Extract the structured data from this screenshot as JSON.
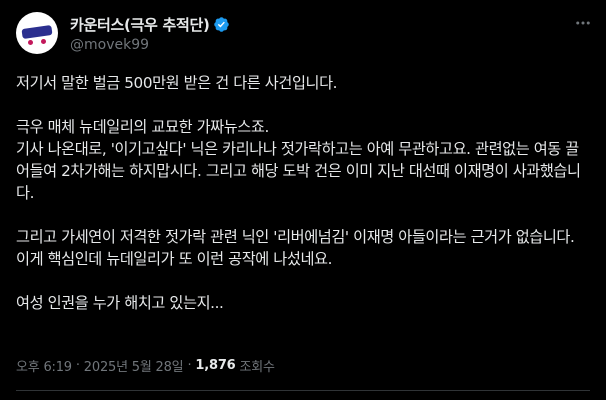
{
  "author": {
    "display_name": "카운터스(극우 추적단)",
    "handle": "@movek99",
    "verified_color": "#1d9bf0"
  },
  "menu": {
    "icon": "more-icon"
  },
  "post": {
    "paragraphs": [
      "저기서 말한 벌금 500만원 받은 건 다른 사건입니다.",
      "극우 매체 뉴데일리의 교묘한 가짜뉴스죠.\n기사 나온대로, '이기고싶다' 닉은 카리나나 젓가락하고는 아예 무관하고요. 관련없는 여동 끌어들여 2차가해는 하지맙시다. 그리고 해당 도박 건은 이미 지난 대선때 이재명이 사과했습니다.",
      "그리고 가세연이 저격한 젓가락 관련 닉인 '리버에넘김' 이재명 아들이라는 근거가 없습니다. 이게 핵심인데 뉴데일리가 또 이런 공작에 나섰네요.",
      "여성 인권을 누가 해치고 있는지..."
    ]
  },
  "meta": {
    "time": "오후 6:19",
    "separator": "·",
    "date": "2025년 5월 28일",
    "views_count": "1,876",
    "views_label": "조회수"
  }
}
